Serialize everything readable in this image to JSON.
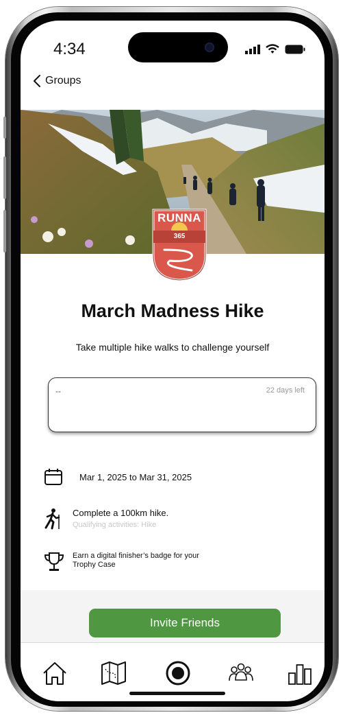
{
  "status_bar": {
    "time": "4:34"
  },
  "nav": {
    "back_label": "Groups"
  },
  "badge": {
    "brand": "RUNNA",
    "number": "365"
  },
  "challenge": {
    "title": "March Madness Hike",
    "subtitle": "Take multiple hike walks to challenge yourself"
  },
  "progress": {
    "value": "--",
    "days_left": "22 days left"
  },
  "details": {
    "dates": "Mar 1, 2025 to Mar 31, 2025",
    "goal": "Complete a 100km hike.",
    "qualifying": "Qualifying activities: Hike",
    "reward_line1": "Earn a digital finisher’s badge for your",
    "reward_line2": "Trophy Case"
  },
  "actions": {
    "invite_label": "Invite Friends"
  },
  "tabbar": {
    "items": [
      {
        "name": "home",
        "icon": "home-icon"
      },
      {
        "name": "map",
        "icon": "map-icon"
      },
      {
        "name": "record",
        "icon": "record-icon"
      },
      {
        "name": "groups",
        "icon": "groups-icon"
      },
      {
        "name": "stats",
        "icon": "bar-chart-icon"
      }
    ]
  },
  "colors": {
    "accent_green": "#4f9741",
    "badge_red": "#d9574b",
    "text": "#111111"
  }
}
